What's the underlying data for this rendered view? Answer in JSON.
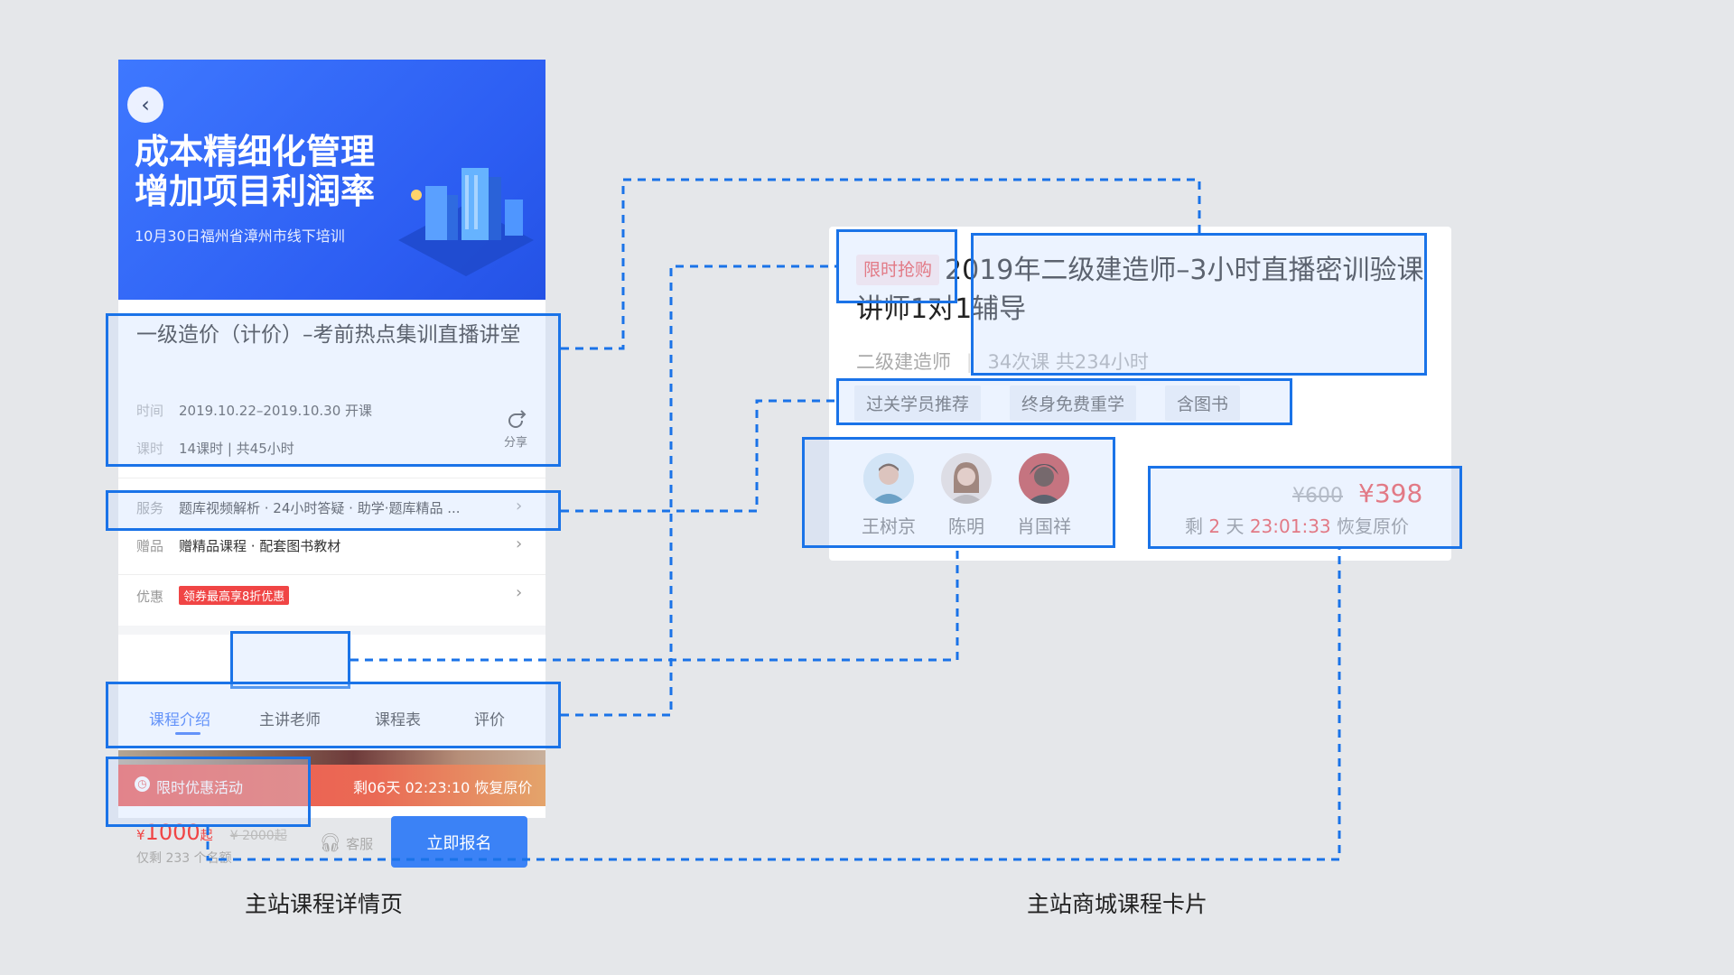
{
  "left_phone": {
    "banner": {
      "title_line1": "成本精细化管理",
      "title_line2": "增加项目利润率",
      "subtitle": "10月30日福州省漳州市线下培训"
    },
    "course": {
      "title": "一级造价（计价）–考前热点集训直播讲堂",
      "time_label": "时间",
      "time_value": "2019.10.22–2019.10.30 开课",
      "lessons_label": "课时",
      "lessons_value": "14课时 | 共45小时",
      "share_label": "分享"
    },
    "rows": [
      {
        "label": "服务",
        "value": "题库视频解析 · 24小时答疑 · 助学·题库精品 ..."
      },
      {
        "label": "赠品",
        "value": "赠精品课程 · 配套图书教材"
      },
      {
        "label": "优惠",
        "badge": "领券最高享8折优惠"
      }
    ],
    "tabs": [
      "课程介绍",
      "主讲老师",
      "课程表",
      "评价"
    ],
    "promo": {
      "label": "限时优惠活动",
      "countdown": "剩06天 02:23:10 恢复原价"
    },
    "bottom": {
      "currency": "¥",
      "price": "1000",
      "price_suffix": "起",
      "old_price": "¥ 2000起",
      "remaining": "仅剩 233 个名额",
      "service": "客服",
      "cta": "立即报名"
    }
  },
  "right_card": {
    "flash_tag": "限时抢购",
    "title": "2019年二级建造师–3小时直播密训验课讲师1对1辅导",
    "meta_category": "二级建造师",
    "meta_info": "34次课 共234小时",
    "tags": [
      "过关学员推荐",
      "终身免费重学",
      "含图书"
    ],
    "teachers": [
      "王树京",
      "陈明",
      "肖国祥"
    ],
    "old_price": "¥600",
    "new_price": "¥398",
    "countdown_prefix": "剩",
    "countdown_days": "2",
    "countdown_unit": "天",
    "countdown_time": "23:01:33",
    "countdown_suffix": "恢复原价"
  },
  "captions": {
    "left": "主站课程详情页",
    "right": "主站商城课程卡片"
  },
  "colors": {
    "background": "#e5e7ea",
    "highlight_border": "#1a73e8",
    "accent_blue": "#2e6cf6",
    "price_red": "#f04545"
  }
}
